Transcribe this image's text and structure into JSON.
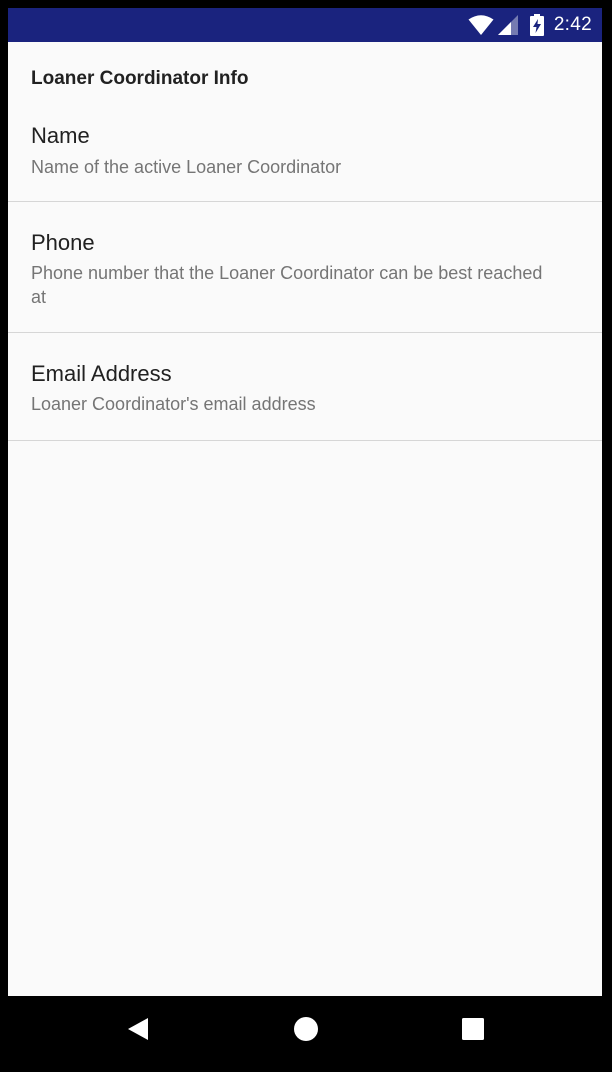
{
  "status_bar": {
    "time": "2:42",
    "background_color": "#1a237e",
    "icons": [
      "wifi-icon",
      "cell-signal-icon",
      "battery-charging-icon"
    ]
  },
  "page": {
    "section_title": "Loaner Coordinator Info",
    "preferences": [
      {
        "title": "Name",
        "summary": "Name of the active Loaner Coordinator"
      },
      {
        "title": "Phone",
        "summary": "Phone number that the Loaner Coordinator can be best reached at"
      },
      {
        "title": "Email Address",
        "summary": "Loaner Coordinator's email address"
      }
    ]
  },
  "nav_bar": {
    "buttons": [
      "back-icon",
      "home-icon",
      "recents-icon"
    ]
  }
}
